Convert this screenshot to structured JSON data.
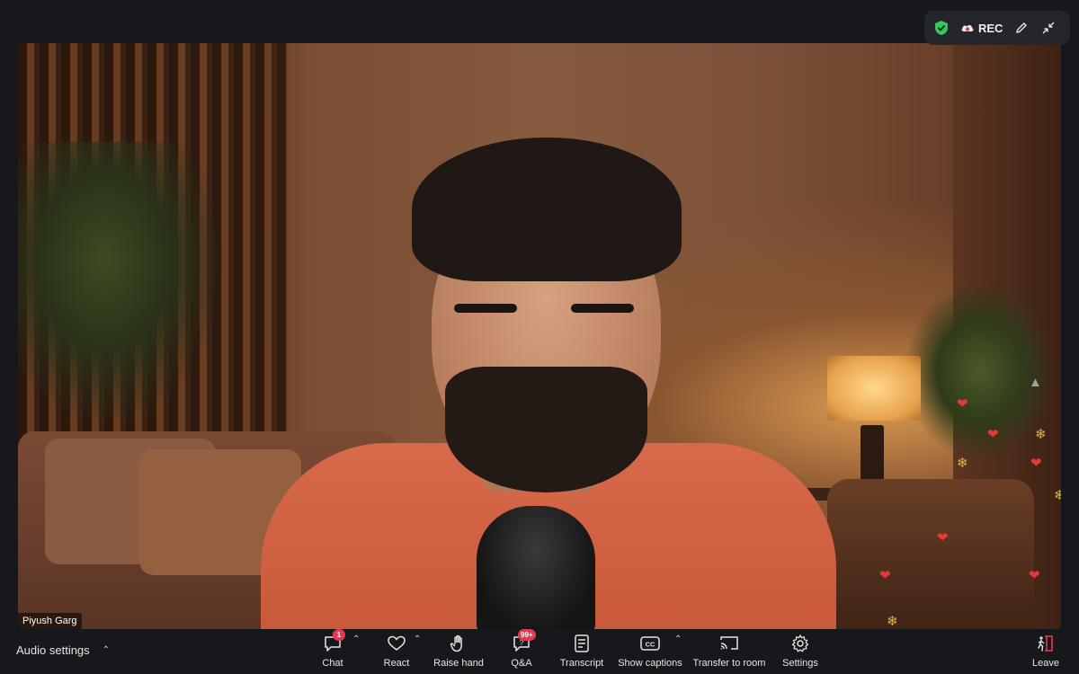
{
  "top_bar": {
    "recording_label": "REC",
    "icons": [
      "shield-check-icon",
      "cloud-record-icon",
      "pencil-icon",
      "collapse-icon"
    ]
  },
  "video": {
    "participant_name": "Piyush Garg"
  },
  "reactions": [
    "heart",
    "heart",
    "clap",
    "heart",
    "clap",
    "heart",
    "thumbs-up",
    "clap",
    "heart",
    "heart",
    "heart",
    "clap"
  ],
  "toolbar": {
    "audio_settings_label": "Audio settings",
    "chat_label": "Chat",
    "chat_badge": "1",
    "react_label": "React",
    "raise_hand_label": "Raise hand",
    "qa_label": "Q&A",
    "qa_badge": "99+",
    "transcript_label": "Transcript",
    "show_captions_label": "Show captions",
    "transfer_label": "Transfer to room",
    "settings_label": "Settings",
    "leave_label": "Leave"
  },
  "colors": {
    "background": "#16181c",
    "badge": "#e53950",
    "shield": "#34c759",
    "leave_accent": "#e53950"
  }
}
